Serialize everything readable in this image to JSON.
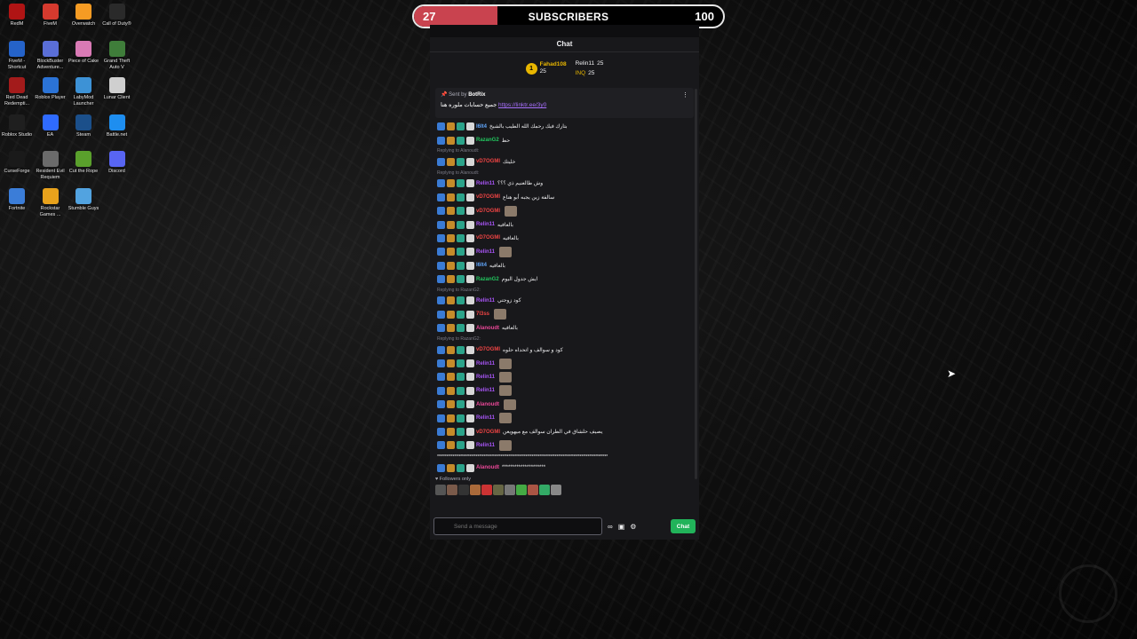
{
  "desktop": {
    "icons": [
      {
        "label": "RedM",
        "icon": "redm-icon",
        "color": "#b01414"
      },
      {
        "label": "FiveM",
        "icon": "fivem-icon",
        "color": "#d53a2e"
      },
      {
        "label": "Overwatch",
        "icon": "overwatch-icon",
        "color": "#f59b23"
      },
      {
        "label": "Call of Duty®",
        "icon": "call-of-duty-icon",
        "color": "#2a2a2a"
      },
      {
        "label": "FiveM - Shortcut",
        "icon": "fivem-icon",
        "color": "#2563c9"
      },
      {
        "label": "BlockBuster Adventure...",
        "icon": "blockbuster-icon",
        "color": "#5a6ed6"
      },
      {
        "label": "Piece of Cake",
        "icon": "piece-of-cake-icon",
        "color": "#d97ab5"
      },
      {
        "label": "Grand Theft Auto V",
        "icon": "gta-icon",
        "color": "#3f7d3a"
      },
      {
        "label": "Red Dead Redempti...",
        "icon": "red-dead-icon",
        "color": "#a31b1b"
      },
      {
        "label": "Roblox Player",
        "icon": "roblox-icon",
        "color": "#2b73d6"
      },
      {
        "label": "LabyMod Launcher",
        "icon": "labymod-icon",
        "color": "#3d92d6"
      },
      {
        "label": "Lunar Client",
        "icon": "lunar-icon",
        "color": "#cfcfcf"
      },
      {
        "label": "Roblox Studio",
        "icon": "roblox-studio-icon",
        "color": "#1f1f1f"
      },
      {
        "label": "EA",
        "icon": "ea-icon",
        "color": "#2f6bff"
      },
      {
        "label": "Steam",
        "icon": "steam-icon",
        "color": "#1b4f8a"
      },
      {
        "label": "Battle.net",
        "icon": "battlenet-icon",
        "color": "#1e8ef0"
      },
      {
        "label": "CurseForge",
        "icon": "curseforge-icon",
        "color": "#1a1a1a"
      },
      {
        "label": "Resident Evil Requiem",
        "icon": "resident-evil-icon",
        "color": "#6b6b6b"
      },
      {
        "label": "Cut the Rope",
        "icon": "cut-the-rope-icon",
        "color": "#5aa02c"
      },
      {
        "label": "Discord",
        "icon": "discord-icon",
        "color": "#5865f2"
      },
      {
        "label": "Fortnite",
        "icon": "fortnite-icon",
        "color": "#3b7dd8"
      },
      {
        "label": "Rockstar Games ...",
        "icon": "rockstar-icon",
        "color": "#e8a21c"
      },
      {
        "label": "Stumble Guys",
        "icon": "stumble-guys-icon",
        "color": "#52a3e0"
      }
    ]
  },
  "subscribers": {
    "title": "SUBSCRIBERS",
    "current": "27",
    "goal": "100",
    "progress": 0.27,
    "fill_color": "#c9434f"
  },
  "chat": {
    "title": "Chat",
    "leaderboard": [
      {
        "name": "Fahad108",
        "count": "25"
      },
      {
        "name": "Relin11",
        "count": "25"
      },
      {
        "name": "INQ",
        "count": "25"
      }
    ],
    "pinned": {
      "sent_by_label": "Sent by",
      "sent_by_user": "BotRix",
      "text": "جميع حسابات ملوره هنا",
      "link": "https://linktr.ee/3y0"
    },
    "messages": [
      {
        "user": "l6lt4",
        "color": "#60a5fa",
        "text": "بتارك فيك رحمك الله الطيب بالشيخ"
      },
      {
        "user": "RazanG2",
        "color": "#22c55e",
        "text": "حط"
      },
      {
        "reply": "Replying to Alanoudt:",
        "user": "vD7OGMl",
        "color": "#ef4444",
        "text": "خليتك"
      },
      {
        "reply": "Replying to Alanoudt:",
        "user": "Relin11",
        "color": "#a855f7",
        "text": "وش طالعنيم ذي ؟؟؟"
      },
      {
        "user": "vD7OGMl",
        "color": "#ef4444",
        "text": "سالفة زين يجبه أبو هناع"
      },
      {
        "user": "vD7OGMl",
        "color": "#ef4444",
        "text": ""
      },
      {
        "user": "Relin11",
        "color": "#a855f7",
        "text": "بالعافيه"
      },
      {
        "user": "vD7OGMl",
        "color": "#ef4444",
        "text": "بالعافيه"
      },
      {
        "user": "Relin11",
        "color": "#a855f7",
        "text": ""
      },
      {
        "user": "l6lt4",
        "color": "#60a5fa",
        "text": "بالعافيه"
      },
      {
        "user": "RazanG2",
        "color": "#22c55e",
        "text": "ايش جدول اليوم"
      },
      {
        "reply": "Replying to RazanG2:",
        "user": "Relin11",
        "color": "#a855f7",
        "text": "كود زوجتي"
      },
      {
        "user": "7l3ss",
        "color": "#ef4444",
        "text": ""
      },
      {
        "user": "Alanoudt",
        "color": "#ec4899",
        "text": "بالعافيه"
      },
      {
        "reply": "Replying to RazanG2:",
        "user": "vD7OGMl",
        "color": "#ef4444",
        "text": "كود و سوالف و اتحداه حلوه"
      },
      {
        "user": "Relin11",
        "color": "#a855f7",
        "text": ""
      },
      {
        "user": "Relin11",
        "color": "#a855f7",
        "text": ""
      },
      {
        "user": "Relin11",
        "color": "#a855f7",
        "text": ""
      },
      {
        "user": "Alanoudt",
        "color": "#ec4899",
        "text": ""
      },
      {
        "user": "Relin11",
        "color": "#a855f7",
        "text": ""
      },
      {
        "user": "vD7OGMl",
        "color": "#ef4444",
        "text": "يصيف حلشاق في الطران سوالف مع ميهويعن"
      },
      {
        "user": "Relin11",
        "color": "#a855f7",
        "text": ""
      }
    ],
    "spam_line": "**************************************************************************************************************",
    "last": {
      "user": "Alanoudt",
      "color": "#ec4899",
      "text": "*********************"
    },
    "followers_only": "Followers only",
    "input_placeholder": "Send a message",
    "chat_button": "Chat"
  }
}
